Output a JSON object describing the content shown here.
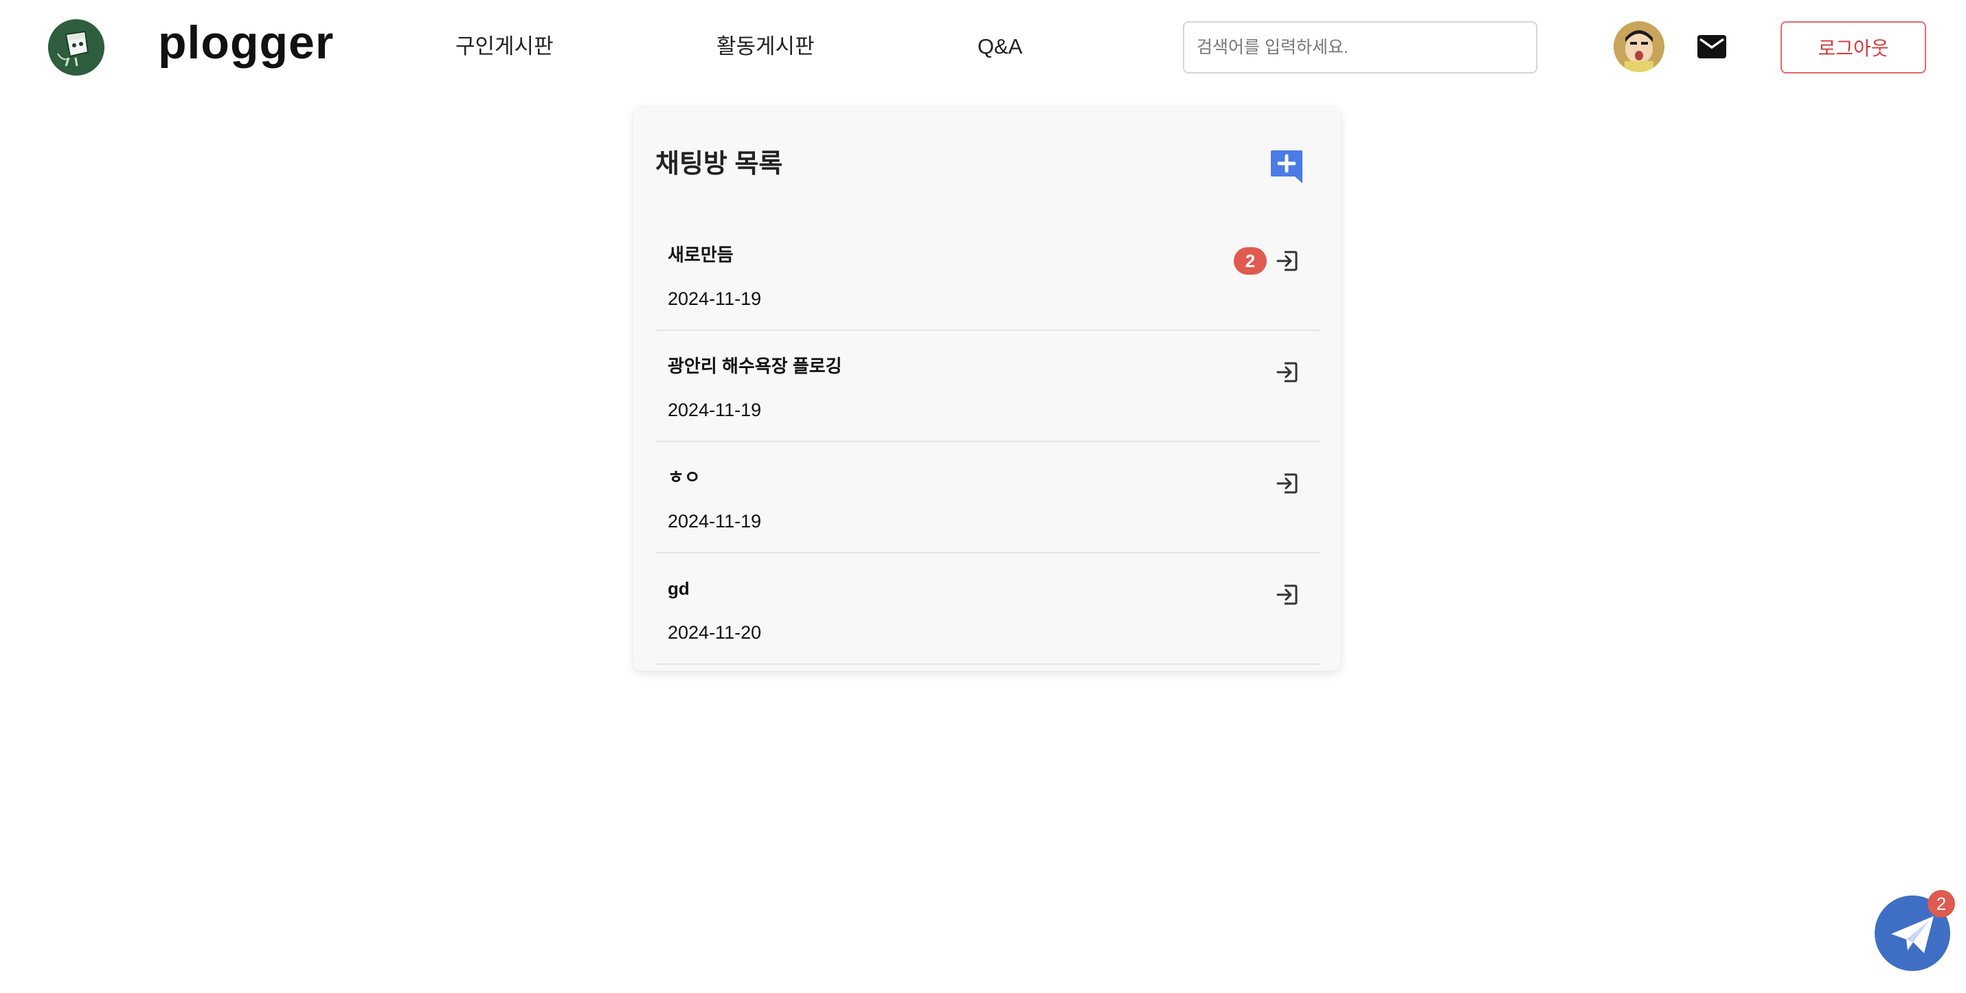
{
  "header": {
    "brand": "plogger",
    "nav": [
      {
        "label": "구인게시판"
      },
      {
        "label": "활동게시판"
      },
      {
        "label": "Q&A"
      }
    ],
    "search": {
      "placeholder": "검색어를 입력하세요.",
      "value": ""
    },
    "logout_label": "로그아웃",
    "icons": {
      "logo": "plogger-logo-icon",
      "avatar": "user-avatar",
      "mail": "mail-icon"
    }
  },
  "chat_list": {
    "title": "채팅방 목록",
    "new_chat_icon": "add-chat-icon",
    "rooms": [
      {
        "name": "새로만듬",
        "date": "2024-11-19",
        "unread": "2"
      },
      {
        "name": "광안리 해수욕장 플로깅",
        "date": "2024-11-19",
        "unread": ""
      },
      {
        "name": "ㅎㅇ",
        "date": "2024-11-19",
        "unread": ""
      },
      {
        "name": "gd",
        "date": "2024-11-20",
        "unread": ""
      }
    ]
  },
  "floating_chat": {
    "icon": "paper-plane-icon",
    "badge": "2"
  },
  "colors": {
    "accent_blue": "#4a7be8",
    "badge_red": "#e05a4f",
    "logout_red": "#d63a3a",
    "logo_green": "#2e5e3e",
    "fab_blue": "#3f6fc4"
  }
}
